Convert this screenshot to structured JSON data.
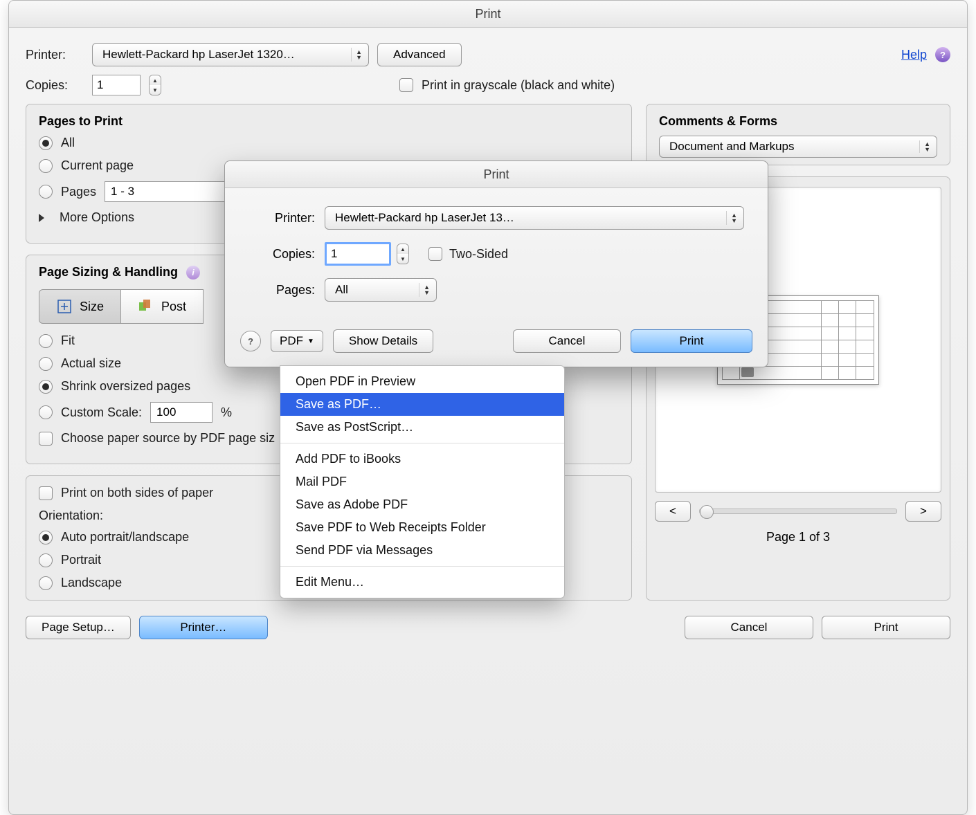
{
  "bg": {
    "title": "Print",
    "printer_label": "Printer:",
    "printer_value": "Hewlett-Packard hp LaserJet 1320…",
    "advanced": "Advanced",
    "help": "Help",
    "copies_label": "Copies:",
    "copies_value": "1",
    "grayscale_label": "Print in grayscale (black and white)",
    "pages_to_print": {
      "title": "Pages to Print",
      "all": "All",
      "current": "Current page",
      "pages": "Pages",
      "pages_value": "1 - 3",
      "more_options": "More Options"
    },
    "comments_forms": {
      "title": "Comments & Forms",
      "value": "Document and Markups"
    },
    "sizing": {
      "title": "Page Sizing & Handling",
      "size": "Size",
      "poster_partial": "Post",
      "fit": "Fit",
      "actual": "Actual size",
      "shrink": "Shrink oversized pages",
      "custom": "Custom Scale:",
      "custom_value": "100",
      "pct": "%",
      "choose_source": "Choose paper source by PDF page siz"
    },
    "both_sides": "Print on both sides of paper",
    "orientation_label": "Orientation:",
    "orientation": {
      "auto": "Auto portrait/landscape",
      "portrait": "Portrait",
      "landscape": "Landscape"
    },
    "page_setup": "Page Setup…",
    "printer_btn": "Printer…",
    "cancel": "Cancel",
    "print": "Print",
    "page_nav_prev": "<",
    "page_nav_next": ">",
    "page_status": "Page 1 of 3"
  },
  "sheet": {
    "title": "Print",
    "printer_label": "Printer:",
    "printer_value": "Hewlett-Packard hp LaserJet 13…",
    "copies_label": "Copies:",
    "copies_value": "1",
    "twosided": "Two-Sided",
    "pages_label": "Pages:",
    "pages_value": "All",
    "pdf": "PDF",
    "show_details": "Show Details",
    "cancel": "Cancel",
    "print": "Print"
  },
  "menu": {
    "open_preview": "Open PDF in Preview",
    "save_pdf": "Save as PDF…",
    "save_ps": "Save as PostScript…",
    "add_ibooks": "Add PDF to iBooks",
    "mail_pdf": "Mail PDF",
    "save_adobe": "Save as Adobe PDF",
    "save_receipts": "Save PDF to Web Receipts Folder",
    "send_messages": "Send PDF via Messages",
    "edit_menu": "Edit Menu…"
  }
}
